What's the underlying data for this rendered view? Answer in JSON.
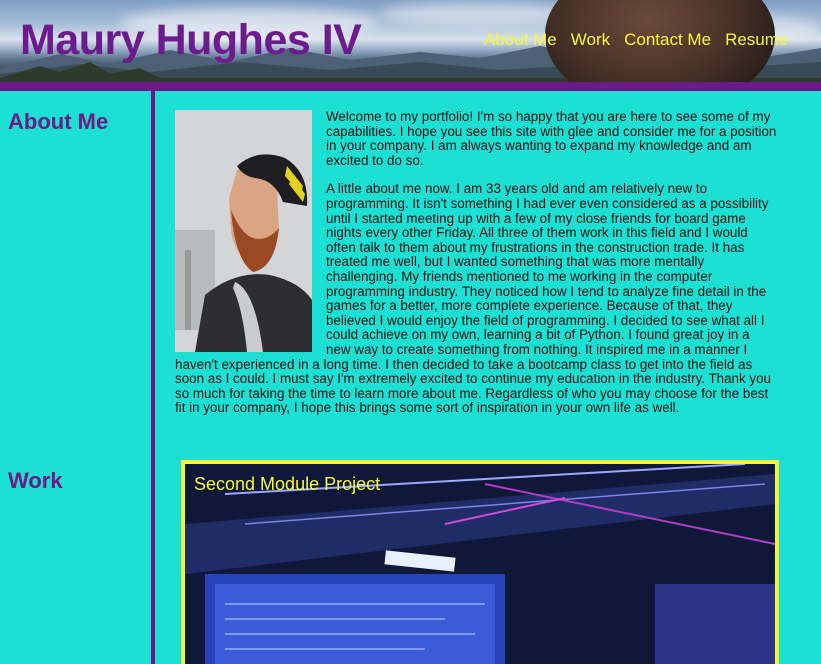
{
  "header": {
    "title": "Maury Hughes IV",
    "nav": [
      {
        "label": "About Me"
      },
      {
        "label": "Work"
      },
      {
        "label": "Contact Me"
      },
      {
        "label": "Resume"
      }
    ]
  },
  "sidebar": {
    "about_heading": "About Me",
    "work_heading": "Work"
  },
  "about": {
    "paragraphs": [
      "Welcome to my portfolio! I'm so happy that you are here to see some of my capabilities. I hope you see this site with glee and consider me for a position in your company. I am always wanting to expand my knowledge and am excited to do so.",
      "A little about me now. I am 33 years old and am relatively new to programming. It isn't something I had ever even considered as a possibility until I started meeting up with a few of my close friends for board game nights every other Friday. All three of them work in this field and I would often talk to them about my frustrations in the construction trade. It has treated me well, but I wanted something that was more mentally challenging. My friends mentioned to me working in the computer programming industry. They noticed how I tend to analyze fine detail in the games for a better, more complete experience. Because of that, they believed I would enjoy the field of programming. I decided to see what all I could achieve on my own, learning a bit of Python. I found great joy in a new way to create something from nothing. It inspired me in a manner I haven't experienced in a long time. I then decided to take a bootcamp class to get into the field as soon as I could. I must say I'm extremely excited to continue my education in the industry. Thank you so much for taking the time to learn more about me. Regardless of who you may choose for the best fit in your company, I hope this brings some sort of inspiration in your own life as well."
    ]
  },
  "work": {
    "projects": [
      {
        "title": "Second Module Project"
      }
    ]
  },
  "colors": {
    "background": "#1de0d4",
    "accent_purple": "#6a1b86",
    "accent_yellow": "#f6f83c"
  }
}
